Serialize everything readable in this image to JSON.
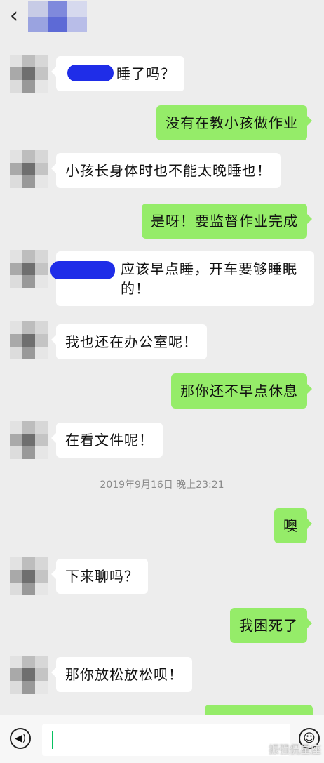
{
  "header": {
    "back_icon": "‹"
  },
  "messages": [
    {
      "dir": "in",
      "text": "睡了吗？"
    },
    {
      "dir": "out",
      "text": "没有在教小孩做作业"
    },
    {
      "dir": "in",
      "text": "小孩长身体时也不能太晚睡也！"
    },
    {
      "dir": "out",
      "text": "是呀！要监督作业完成"
    },
    {
      "dir": "in",
      "text": "应该早点睡，开车要够睡眠的！"
    },
    {
      "dir": "in",
      "text": "我也还在办公室呢！"
    },
    {
      "dir": "out",
      "text": "那你还不早点休息"
    },
    {
      "dir": "in",
      "text": "在看文件呢！"
    },
    {
      "dir": "out",
      "text": "噢"
    },
    {
      "dir": "in",
      "text": "下来聊吗？"
    },
    {
      "dir": "out",
      "text": "我困死了"
    },
    {
      "dir": "in",
      "text": "那你放松放松呗！"
    }
  ],
  "timestamp": "2019年9月16日 晚上23:21",
  "input": {
    "voice_icon": "◀)",
    "emoji_icon": "☺"
  },
  "watermark": "振强侃星座"
}
